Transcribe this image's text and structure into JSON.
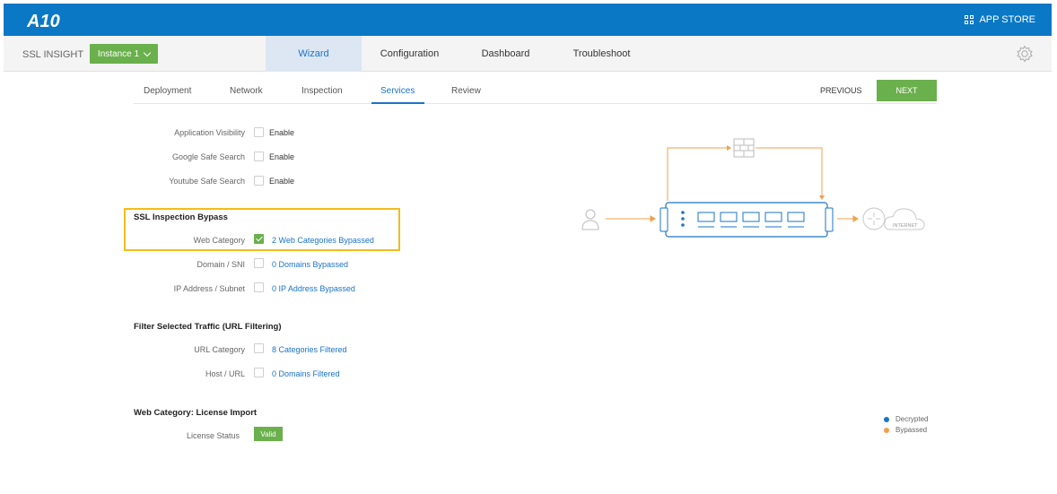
{
  "header": {
    "logo_text": "A10",
    "app_store_label": "APP STORE"
  },
  "subbar": {
    "product": "SSL INSIGHT",
    "instance_label": "Instance 1",
    "tabs": [
      {
        "label": "Wizard",
        "active": true
      },
      {
        "label": "Configuration",
        "active": false
      },
      {
        "label": "Dashboard",
        "active": false
      },
      {
        "label": "Troubleshoot",
        "active": false
      }
    ]
  },
  "wizard": {
    "steps": [
      {
        "label": "Deployment"
      },
      {
        "label": "Network"
      },
      {
        "label": "Inspection"
      },
      {
        "label": "Services",
        "active": true
      },
      {
        "label": "Review"
      }
    ],
    "previous_label": "PREVIOUS",
    "next_label": "NEXT"
  },
  "services": [
    {
      "label": "Application Visibility",
      "checked": false,
      "value": "Enable"
    },
    {
      "label": "Google Safe Search",
      "checked": false,
      "value": "Enable"
    },
    {
      "label": "Youtube Safe Search",
      "checked": false,
      "value": "Enable"
    }
  ],
  "ssl_bypass": {
    "title": "SSL Inspection Bypass",
    "rows": [
      {
        "label": "Web Category",
        "checked": true,
        "link": "2 Web Categories Bypassed"
      },
      {
        "label": "Domain / SNI",
        "checked": false,
        "link": "0 Domains Bypassed"
      },
      {
        "label": "IP Address / Subnet",
        "checked": false,
        "link": "0 IP Address Bypassed"
      }
    ]
  },
  "url_filtering": {
    "title": "Filter Selected Traffic (URL Filtering)",
    "rows": [
      {
        "label": "URL Category",
        "checked": false,
        "link": "8 Categories Filtered"
      },
      {
        "label": "Host / URL",
        "checked": false,
        "link": "0 Domains Filtered"
      }
    ]
  },
  "license": {
    "title": "Web Category: License Import",
    "status_label": "License Status",
    "status_value": "Valid"
  },
  "diagram": {
    "internet_label": "INTERNET"
  },
  "legend": [
    {
      "label": "Decrypted",
      "color": "#1a73c8"
    },
    {
      "label": "Bypassed",
      "color": "#f0a04b"
    }
  ],
  "colors": {
    "brand_blue": "#0b78c6",
    "accent_green": "#6ab04c",
    "highlight_yellow": "#f2bd19",
    "link_blue": "#1a73c8"
  }
}
